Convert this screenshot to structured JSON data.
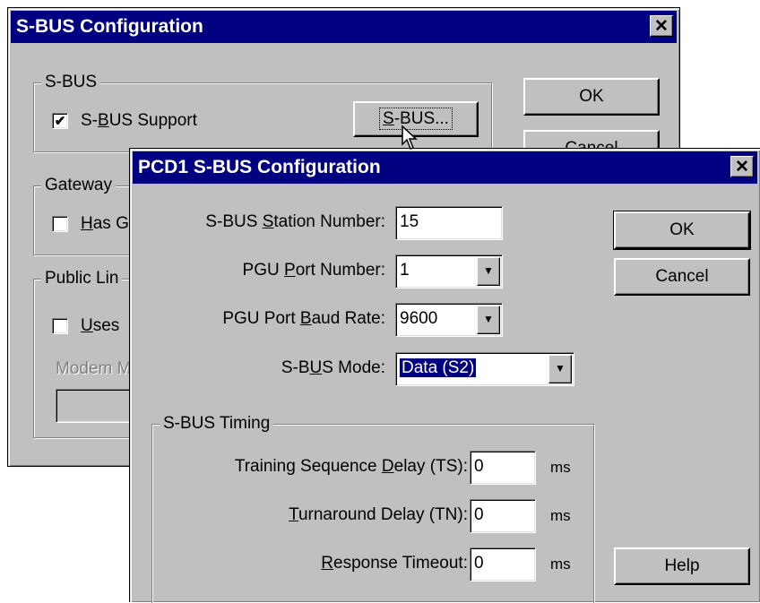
{
  "bg_dialog": {
    "title": "S-BUS Configuration",
    "close_glyph": "✕",
    "sbus_group": {
      "label": "S-BUS",
      "support_checked": true,
      "support_pre": "S-",
      "support_ul": "B",
      "support_post": "US Support",
      "sbus_btn_pre": "",
      "sbus_btn_ul": "S",
      "sbus_btn_post": "-BUS..."
    },
    "ok": "OK",
    "cancel": "Cancel",
    "gateway_group": {
      "label": "Gateway",
      "check_ul": "H",
      "check_post": "as G"
    },
    "public_group": {
      "label": "Public Lin",
      "check_ul": "U",
      "check_post": "ses",
      "modem_label": "Modem M"
    }
  },
  "fg_dialog": {
    "title": "PCD1 S-BUS Configuration",
    "close_glyph": "✕",
    "station": {
      "pre": "S-BUS ",
      "ul": "S",
      "post": "tation Number:",
      "value": "15"
    },
    "pgu_port": {
      "pre": "PGU ",
      "ul": "P",
      "post": "ort Number:",
      "value": "1"
    },
    "baud": {
      "pre": "PGU Port ",
      "ul": "B",
      "post": "aud Rate:",
      "value": "9600"
    },
    "mode": {
      "pre": "S-B",
      "ul": "U",
      "post": "S Mode:",
      "value": "Data (S2)"
    },
    "timing_group": {
      "label": "S-BUS Timing",
      "ts": {
        "pre": "Training Sequence ",
        "ul": "D",
        "post": "elay (TS):",
        "value": "0",
        "unit": "ms"
      },
      "tn": {
        "pre": "",
        "ul": "T",
        "post": "urnaround Delay (TN):",
        "value": "0",
        "unit": "ms"
      },
      "rt": {
        "pre": "",
        "ul": "R",
        "post": "esponse Timeout:",
        "value": "0",
        "unit": "ms"
      }
    },
    "ok": "OK",
    "cancel": "Cancel",
    "help": "Help",
    "dropdown_glyph": "▼",
    "check_glyph": "✔"
  }
}
